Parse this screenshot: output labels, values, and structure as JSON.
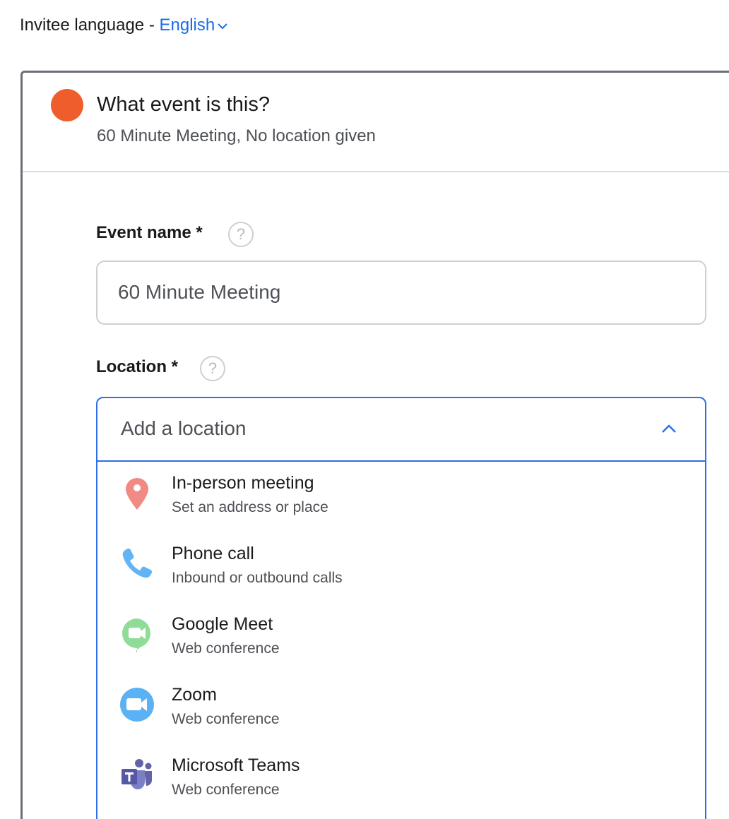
{
  "language": {
    "label": "Invitee language - ",
    "value": "English"
  },
  "section": {
    "title": "What event is this?",
    "summary": "60 Minute Meeting, No location given",
    "status_color": "#f05d2c"
  },
  "event_name": {
    "label": "Event name *",
    "help": "?",
    "value": "60 Minute Meeting"
  },
  "location": {
    "label": "Location *",
    "help": "?",
    "placeholder": "Add a location",
    "options": [
      {
        "title": "In-person meeting",
        "subtitle": "Set an address or place",
        "icon": "map-pin-icon"
      },
      {
        "title": "Phone call",
        "subtitle": "Inbound or outbound calls",
        "icon": "phone-icon"
      },
      {
        "title": "Google Meet",
        "subtitle": "Web conference",
        "icon": "google-meet-icon"
      },
      {
        "title": "Zoom",
        "subtitle": "Web conference",
        "icon": "zoom-icon"
      },
      {
        "title": "Microsoft Teams",
        "subtitle": "Web conference",
        "icon": "microsoft-teams-icon"
      }
    ]
  },
  "colors": {
    "accent": "#2f6fea",
    "link": "#1a6ce8"
  }
}
